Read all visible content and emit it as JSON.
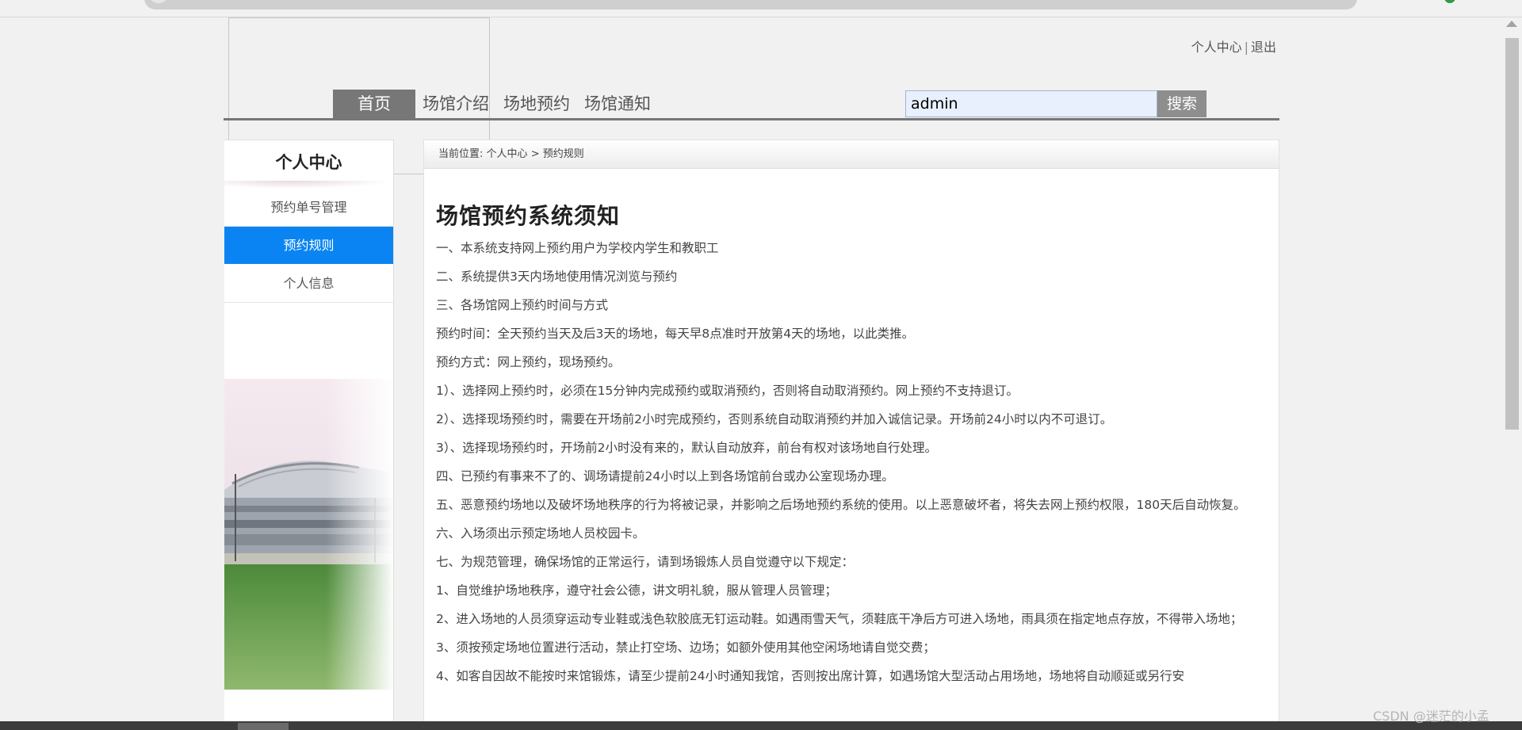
{
  "top_links": {
    "personal_center": "个人中心",
    "separator": "|",
    "logout": "退出"
  },
  "nav": {
    "items": [
      {
        "label": "首页",
        "active": true
      },
      {
        "label": "场馆介绍",
        "active": false
      },
      {
        "label": "场地预约",
        "active": false
      },
      {
        "label": "场馆通知",
        "active": false
      }
    ]
  },
  "search": {
    "value": "admin",
    "button_label": "搜索"
  },
  "sidebar": {
    "title": "个人中心",
    "items": [
      {
        "label": "预约单号管理",
        "active": false
      },
      {
        "label": "预约规则",
        "active": true
      },
      {
        "label": "个人信息",
        "active": false
      }
    ]
  },
  "breadcrumb": {
    "prefix": "当前位置:",
    "level1": "个人中心",
    "separator": ">",
    "level2": "预约规则"
  },
  "article": {
    "title": "场馆预约系统须知",
    "paragraphs": [
      "一、本系统支持网上预约用户为学校内学生和教职工",
      "二、系统提供3天内场地使用情况浏览与预约",
      "三、各场馆网上预约时间与方式",
      "预约时间：全天预约当天及后3天的场地，每天早8点准时开放第4天的场地，以此类推。",
      "预约方式：网上预约，现场预约。",
      "1）、选择网上预约时，必须在15分钟内完成预约或取消预约，否则将自动取消预约。网上预约不支持退订。",
      "2）、选择现场预约时，需要在开场前2小时完成预约，否则系统自动取消预约并加入诚信记录。开场前24小时以内不可退订。",
      "3）、选择现场预约时，开场前2小时没有来的，默认自动放弃，前台有权对该场地自行处理。",
      "四、已预约有事来不了的、调场请提前24小时以上到各场馆前台或办公室现场办理。",
      "五、恶意预约场地以及破坏场地秩序的行为将被记录，并影响之后场地预约系统的使用。以上恶意破坏者，将失去网上预约权限，180天后自动恢复。",
      "六、入场须出示预定场地人员校园卡。",
      "七、为规范管理，确保场馆的正常运行，请到场锻炼人员自觉遵守以下规定：",
      "1、自觉维护场地秩序，遵守社会公德，讲文明礼貌，服从管理人员管理；",
      "2、进入场地的人员须穿运动专业鞋或浅色软胶底无钉运动鞋。如遇雨雪天气，须鞋底干净后方可进入场地，雨具须在指定地点存放，不得带入场地；",
      "3、须按预定场地位置进行活动，禁止打空场、边场；如额外使用其他空闲场地请自觉交费；",
      "4、如客自因故不能按时来馆锻炼，请至少提前24小时通知我馆，否则按出席计算，如遇场馆大型活动占用场地，场地将自动顺延或另行安"
    ]
  },
  "watermark": "CSDN @迷茫的小孟",
  "colors": {
    "nav_active_bg": "#777777",
    "sidebar_active_bg": "#0a84f2",
    "search_btn_bg": "#8e8e8e"
  }
}
